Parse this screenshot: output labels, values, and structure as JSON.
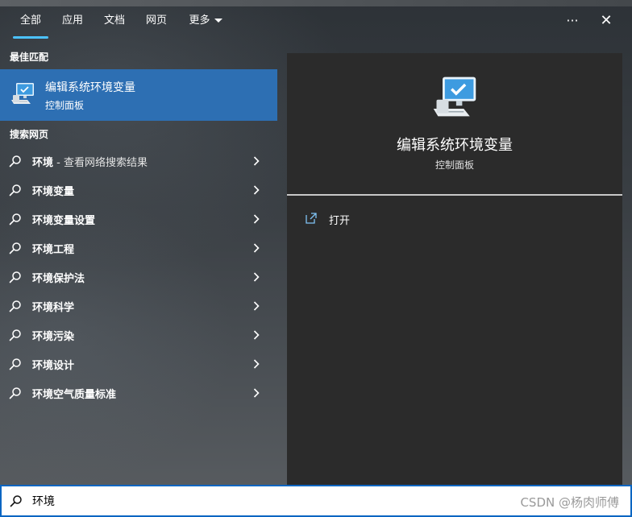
{
  "tabs": [
    {
      "label": "全部",
      "active": true
    },
    {
      "label": "应用"
    },
    {
      "label": "文档"
    },
    {
      "label": "网页"
    },
    {
      "label": "更多"
    }
  ],
  "top_actions": {
    "more_glyph": "···",
    "close_glyph": "✕"
  },
  "best_match": {
    "section_label": "最佳匹配",
    "title": "编辑系统环境变量",
    "subtitle": "控制面板",
    "icon": "computer-monitor-icon"
  },
  "web": {
    "section_label": "搜索网页",
    "items": [
      {
        "label": "环境",
        "suffix": " - 查看网络搜索结果"
      },
      {
        "label": "环境变量"
      },
      {
        "label": "环境变量设置"
      },
      {
        "label": "环境工程"
      },
      {
        "label": "环境保护法"
      },
      {
        "label": "环境科学"
      },
      {
        "label": "环境污染"
      },
      {
        "label": "环境设计"
      },
      {
        "label": "环境空气质量标准"
      }
    ]
  },
  "preview": {
    "title": "编辑系统环境变量",
    "subtitle": "控制面板",
    "open_label": "打开"
  },
  "search": {
    "value": "环境"
  },
  "watermark": "CSDN @杨肉师傅",
  "colors": {
    "accent": "#4cc2ff",
    "selection": "#2d6fb3",
    "search_border": "#0a66c2",
    "preview_bg": "#2b2b2b"
  }
}
